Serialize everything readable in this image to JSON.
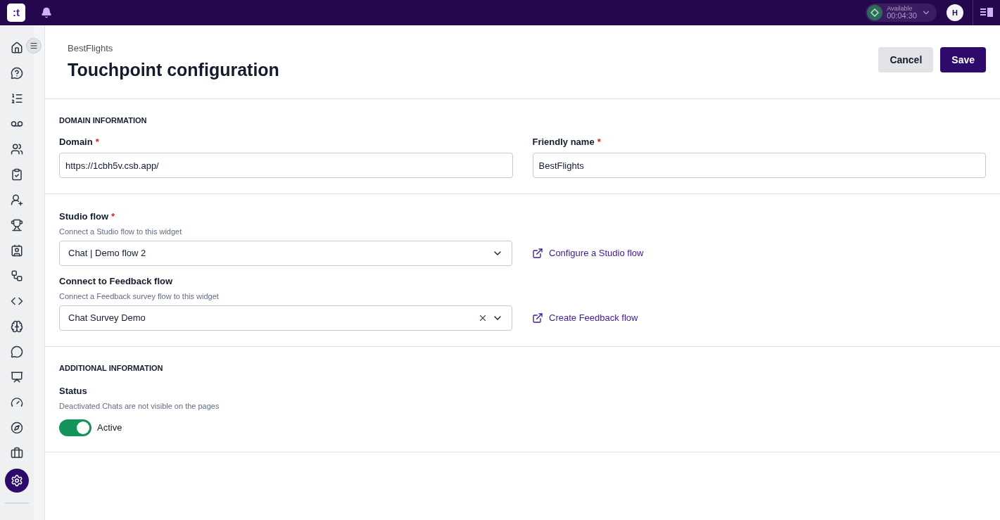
{
  "topbar": {
    "logo": ":t",
    "status": {
      "label": "Available",
      "timer": "00:04:30"
    },
    "avatar": "H"
  },
  "sidebar": {
    "items": [
      {
        "selected": false
      },
      {
        "selected": false
      },
      {
        "selected": false
      },
      {
        "selected": false
      },
      {
        "selected": false
      },
      {
        "selected": false
      },
      {
        "selected": false
      },
      {
        "selected": false
      },
      {
        "selected": false
      },
      {
        "selected": false
      },
      {
        "selected": false
      },
      {
        "selected": false
      },
      {
        "selected": false
      },
      {
        "selected": false
      },
      {
        "selected": false
      },
      {
        "selected": false
      },
      {
        "selected": false
      },
      {
        "selected": true
      }
    ]
  },
  "header": {
    "breadcrumb": "BestFlights",
    "title": "Touchpoint configuration",
    "buttons": [
      {
        "label": "Cancel",
        "kind": "secondary"
      },
      {
        "label": "Save",
        "kind": "primary"
      }
    ]
  },
  "domain_section": {
    "heading": "DOMAIN INFORMATION",
    "fields": [
      {
        "label": "Domain",
        "required_mark": "*",
        "value": "https://1cbh5v.csb.app/"
      },
      {
        "label": "Friendly name",
        "required_mark": "*",
        "value": "BestFlights"
      }
    ]
  },
  "flow_section": {
    "selects": [
      {
        "label": "Studio flow",
        "required_mark": "*",
        "hint": "Connect a Studio flow to this widget",
        "value": "Chat | Demo flow 2",
        "clearable": false,
        "link": "Configure a Studio flow"
      },
      {
        "label": "Connect to Feedback flow",
        "hint": "Connect a Feedback survey flow to this widget",
        "value": "Chat Survey Demo",
        "clearable": true,
        "link": "Create Feedback flow"
      }
    ]
  },
  "additional_section": {
    "heading": "ADDITIONAL INFORMATION",
    "status": {
      "label": "Status",
      "hint": "Deactivated Chats are not visible on the pages",
      "on": true,
      "text": "Active"
    }
  }
}
